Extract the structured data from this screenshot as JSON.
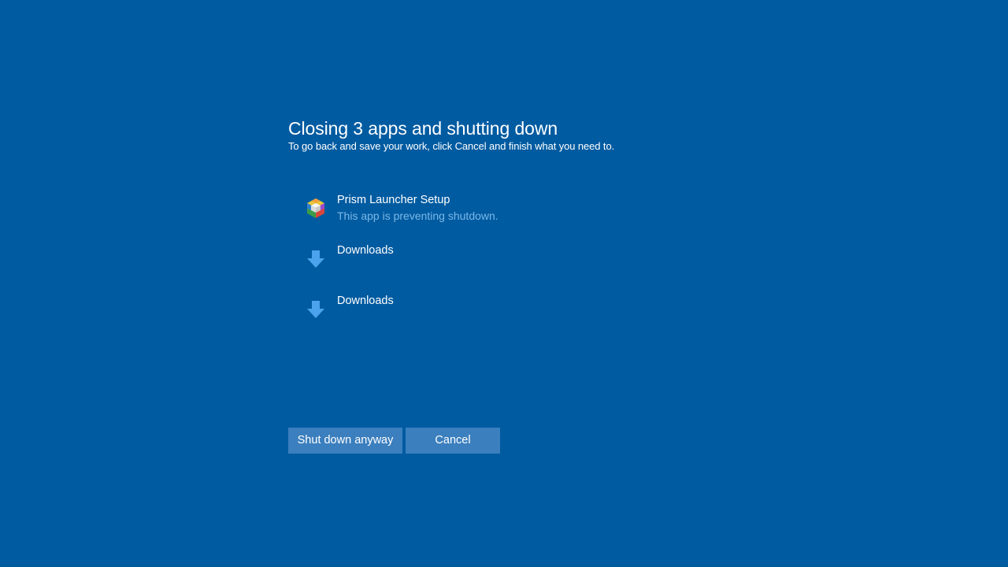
{
  "dialog": {
    "title": "Closing 3 apps and shutting down",
    "subtitle": "To go back and save your work, click Cancel and finish what you need to."
  },
  "apps": [
    {
      "name": "Prism Launcher Setup",
      "status": "This app is preventing shutdown.",
      "icon": "prism-launcher-icon"
    },
    {
      "name": "Downloads",
      "status": "",
      "icon": "download-arrow-icon"
    },
    {
      "name": "Downloads",
      "status": "",
      "icon": "download-arrow-icon"
    }
  ],
  "buttons": {
    "shutdown_label": "Shut down anyway",
    "cancel_label": "Cancel"
  },
  "colors": {
    "background": "#005ba1",
    "status_text": "#7ab8e8",
    "button": "#3b7fbe",
    "download_icon": "#4aa3ec"
  }
}
